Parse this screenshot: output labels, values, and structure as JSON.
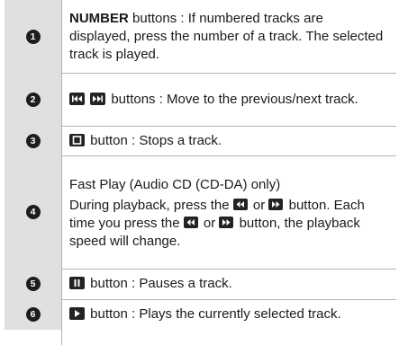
{
  "rows": [
    {
      "num": "1",
      "label_bold": "NUMBER",
      "text": " buttons : If numbered tracks are displayed, press the number of a track. The selected track is played."
    },
    {
      "num": "2",
      "text": " buttons : Move to the previous/next track.",
      "icons": [
        "skip-back-icon",
        "skip-forward-icon"
      ]
    },
    {
      "num": "3",
      "text": " button : Stops a track.",
      "icons": [
        "stop-icon"
      ]
    },
    {
      "num": "4",
      "title": "Fast Play (Audio CD (CD-DA) only)",
      "text_a": "During playback, press the ",
      "or": " or ",
      "text_b": " button.",
      "text_c": "Each time you press the ",
      "text_d": " button, the playback speed will change.",
      "icons": [
        "rewind-icon",
        "fast-forward-icon"
      ]
    },
    {
      "num": "5",
      "text": " button : Pauses a track.",
      "icons": [
        "pause-icon"
      ]
    },
    {
      "num": "6",
      "text": " button : Plays the currently selected track.",
      "icons": [
        "play-icon"
      ]
    }
  ]
}
